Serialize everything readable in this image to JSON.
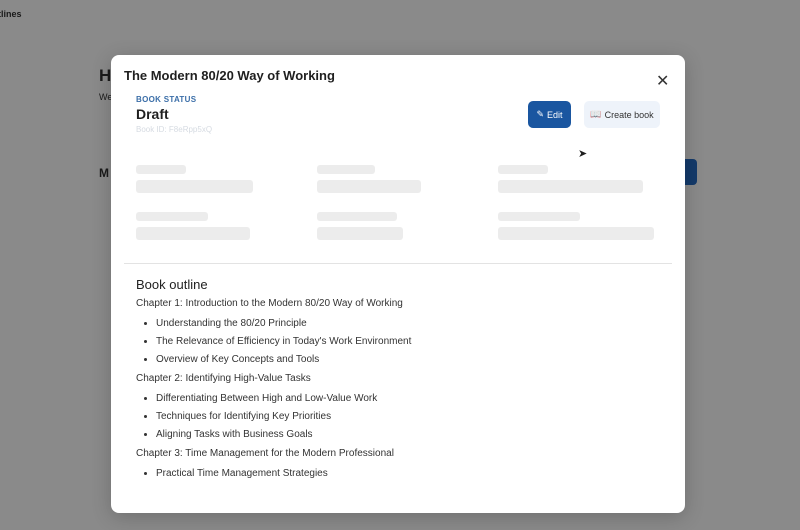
{
  "background": {
    "nav_title": "tlines",
    "heading": "H",
    "subtext": "We",
    "section": "M"
  },
  "modal": {
    "title": "The Modern 80/20 Way of Working",
    "close_icon": "close-icon",
    "status_label": "BOOK STATUS",
    "status": "Draft",
    "book_id": "Book ID: F8eRpp5xQ",
    "edit_label": "Edit",
    "create_label": "Create book",
    "outline": {
      "heading": "Book outline",
      "chapters": [
        {
          "title": "Chapter 1: Introduction to the Modern 80/20 Way of Working",
          "items": [
            "Understanding the 80/20 Principle",
            "The Relevance of Efficiency in Today's Work Environment",
            "Overview of Key Concepts and Tools"
          ]
        },
        {
          "title": "Chapter 2: Identifying High-Value Tasks",
          "items": [
            "Differentiating Between High and Low-Value Work",
            "Techniques for Identifying Key Priorities",
            "Aligning Tasks with Business Goals"
          ]
        },
        {
          "title": "Chapter 3: Time Management for the Modern Professional",
          "items": [
            "Practical Time Management Strategies"
          ]
        }
      ]
    }
  },
  "colors": {
    "primary": "#1a56a0",
    "overlay": "#8a8a8a"
  }
}
